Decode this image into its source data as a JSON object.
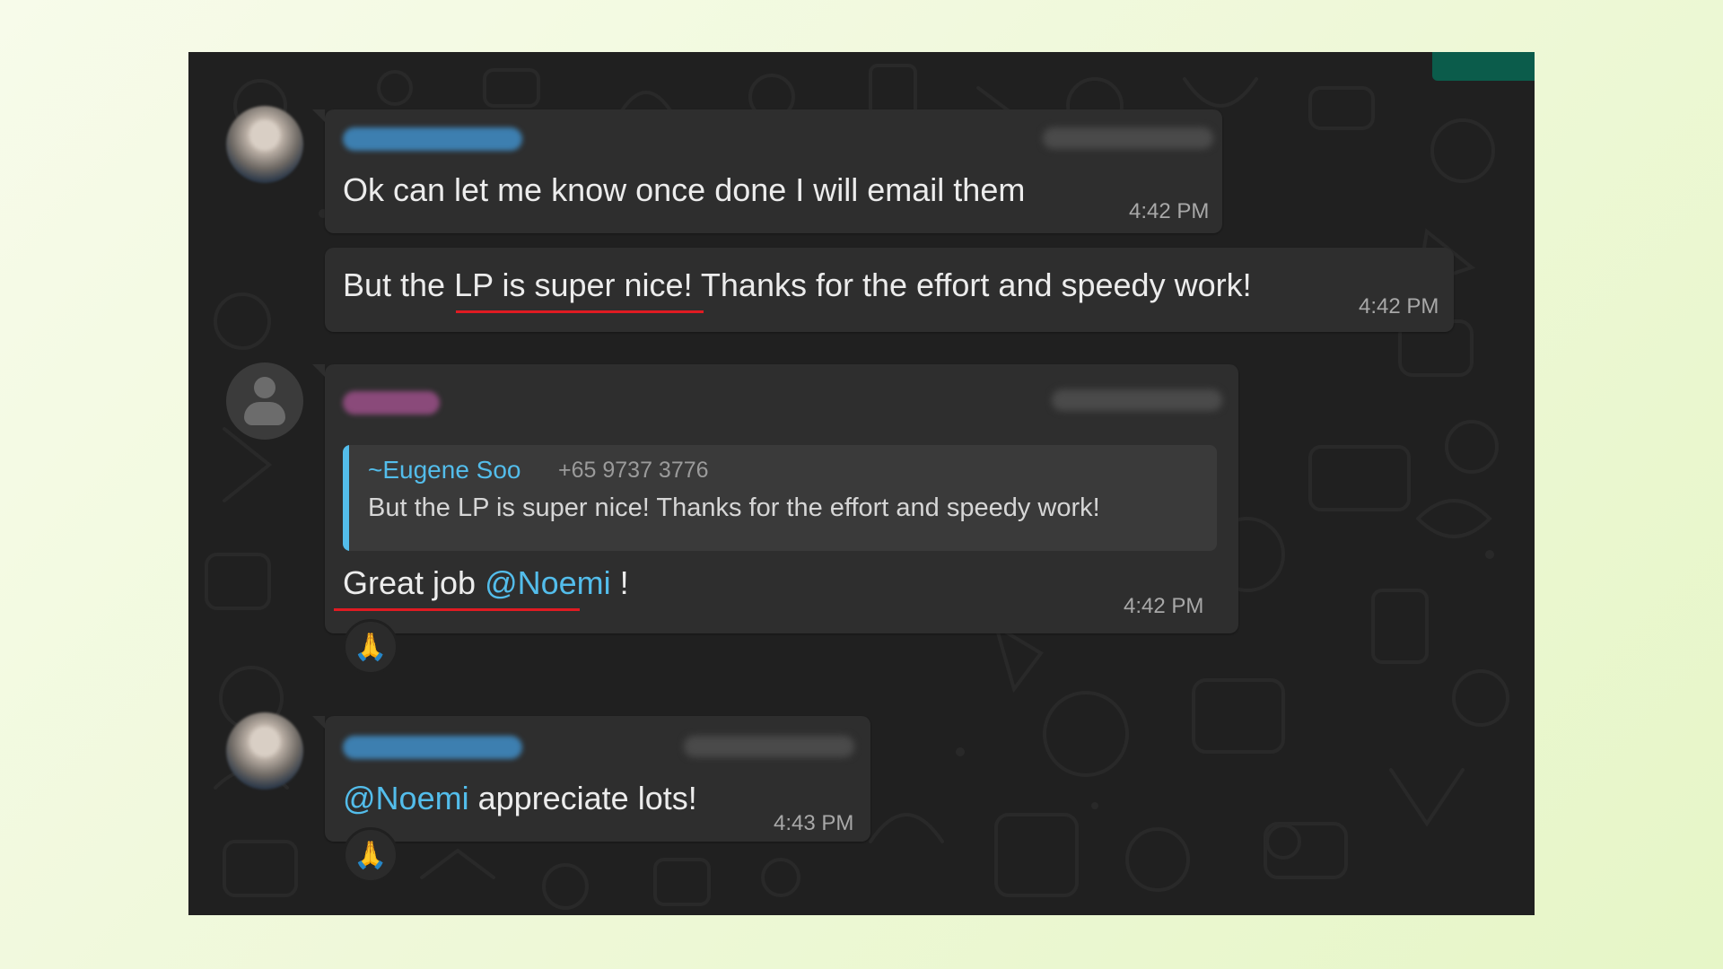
{
  "colors": {
    "page_bg": "#eef8d7",
    "chat_bg": "#202020",
    "bubble_bg": "#2e2e2e",
    "mention": "#53bdeb",
    "timestamp": "#a8a8a8",
    "underline": "#e01b22",
    "top_indicator": "#0b5c4b"
  },
  "messages": [
    {
      "sender_avatar": "blurred-photo-avatar",
      "text": "Ok can let me know once done I will email them",
      "time": "4:42 PM"
    },
    {
      "text": "But the LP is super nice! Thanks for the effort and speedy work!",
      "time": "4:42 PM"
    },
    {
      "sender_avatar": "default-person-avatar",
      "quote": {
        "name": "~Eugene Soo",
        "phone": "+65 9737 3776",
        "text": "But the LP is super nice! Thanks for the effort and speedy work!"
      },
      "text_prefix": "Great job ",
      "mention": "@Noemi",
      "text_suffix": " !",
      "time": "4:42 PM",
      "reaction": "🙏"
    },
    {
      "sender_avatar": "blurred-photo-avatar",
      "mention": "@Noemi",
      "text_suffix": " appreciate lots!",
      "time": "4:43 PM",
      "reaction": "🙏"
    }
  ]
}
